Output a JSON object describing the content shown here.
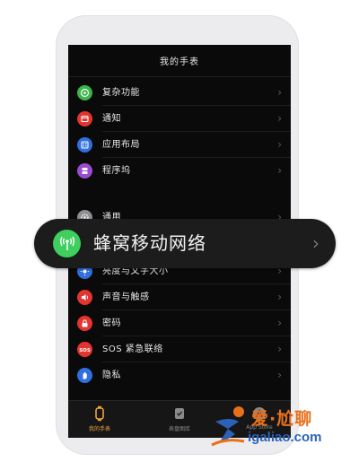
{
  "header": {
    "title": "我的手表"
  },
  "settings_group_1": [
    {
      "label": "复杂功能",
      "icon": "complications-icon",
      "color": "#3bb54a"
    },
    {
      "label": "通知",
      "icon": "notifications-icon",
      "color": "#e3342f"
    },
    {
      "label": "应用布局",
      "icon": "app-layout-icon",
      "color": "#2f6fe0"
    },
    {
      "label": "程序坞",
      "icon": "dock-icon",
      "color": "#9b4bd0"
    }
  ],
  "settings_group_2": [
    {
      "label": "通用",
      "icon": "general-icon",
      "color": "#8e8e93"
    },
    {
      "label": "亮度与文字大小",
      "icon": "brightness-icon",
      "color": "#2f6fe0"
    },
    {
      "label": "声音与触感",
      "icon": "sounds-icon",
      "color": "#e3342f"
    },
    {
      "label": "密码",
      "icon": "passcode-icon",
      "color": "#e3342f"
    },
    {
      "label": "SOS 紧急联络",
      "icon": "sos-icon",
      "color": "#e3342f"
    },
    {
      "label": "隐私",
      "icon": "privacy-icon",
      "color": "#2f6fe0"
    }
  ],
  "overlay_item": {
    "label": "蜂窝移动网络",
    "icon": "cellular-icon",
    "color": "#3fcf5e"
  },
  "tabbar": [
    {
      "label": "我的手表",
      "icon": "watch-icon",
      "active": true
    },
    {
      "label": "表盘图库",
      "icon": "face-gallery-icon",
      "active": false
    },
    {
      "label": "App Store",
      "icon": "app-store-icon",
      "active": false
    }
  ],
  "watermark": {
    "brand": "爱·尬聊",
    "url": "igaliao.com"
  }
}
